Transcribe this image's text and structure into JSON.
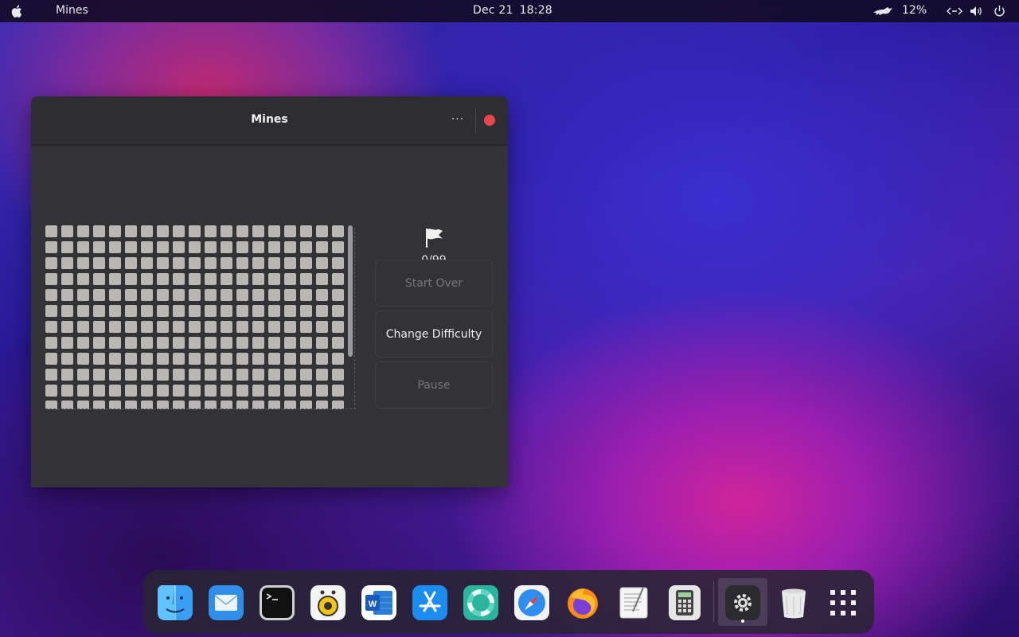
{
  "topbar": {
    "app_name": "Mines",
    "date": "Dec 21",
    "time": "18:28",
    "battery": "12%",
    "icons": [
      "apple-icon",
      "cat-icon",
      "network-icon",
      "volume-icon",
      "power-icon"
    ]
  },
  "window": {
    "title": "Mines",
    "menu_label": "···",
    "flag_count": "0/99",
    "buttons": {
      "start_over": "Start Over",
      "change_difficulty": "Change Difficulty",
      "pause": "Pause"
    },
    "board": {
      "visible_columns": 19,
      "visible_rows": 12
    }
  },
  "dock": {
    "apps": [
      "finder",
      "mail",
      "terminal",
      "rhythmbox",
      "word",
      "app-store",
      "lifesaver",
      "safari",
      "firefox",
      "text-editor",
      "calculator",
      "settings",
      "trash",
      "app-grid"
    ],
    "active_app": "settings"
  },
  "colors": {
    "window_bg": "#333236",
    "cell": "#b8b7b3",
    "close": "#e8454d",
    "accent": "#2f7de1"
  }
}
